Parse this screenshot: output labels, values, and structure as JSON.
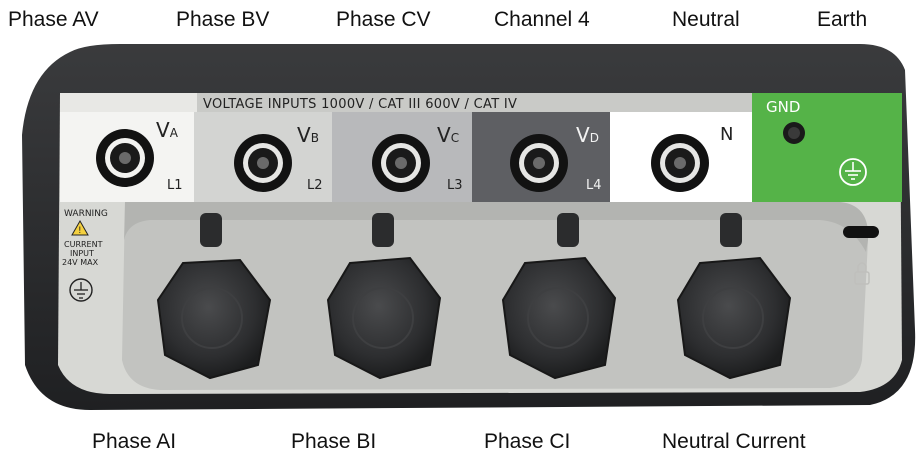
{
  "top_labels": {
    "phase_av": "Phase AV",
    "phase_bv": "Phase BV",
    "phase_cv": "Phase CV",
    "channel_4": "Channel 4",
    "neutral": "Neutral",
    "earth": "Earth"
  },
  "bottom_labels": {
    "phase_ai": "Phase AI",
    "phase_bi": "Phase BI",
    "phase_ci": "Phase CI",
    "neutral_current": "Neutral Current"
  },
  "panel": {
    "header": "VOLTAGE INPUTS  1000V /  CAT III    600V / CAT IV",
    "gnd": "GND",
    "warning": {
      "title": "WARNING",
      "line1": "CURRENT",
      "line2": "INPUT",
      "line3": "24V MAX"
    }
  },
  "voltage_jacks": [
    {
      "name": "V",
      "sub": "A",
      "line": "L1"
    },
    {
      "name": "V",
      "sub": "B",
      "line": "L2"
    },
    {
      "name": "V",
      "sub": "C",
      "line": "L3"
    },
    {
      "name": "V",
      "sub": "D",
      "line": "L4"
    },
    {
      "name": "N",
      "sub": "",
      "line": ""
    }
  ],
  "colors": {
    "case": "#2a2b2d",
    "panel_light": "#d7d8d4",
    "va_bg": "#f4f4f2",
    "vb_bg": "#d3d4d2",
    "vc_bg": "#b8b9bb",
    "vd_bg": "#5e5f63",
    "n_bg": "#ffffff",
    "gnd_bg": "#55b348",
    "cap": "#2f3031"
  }
}
